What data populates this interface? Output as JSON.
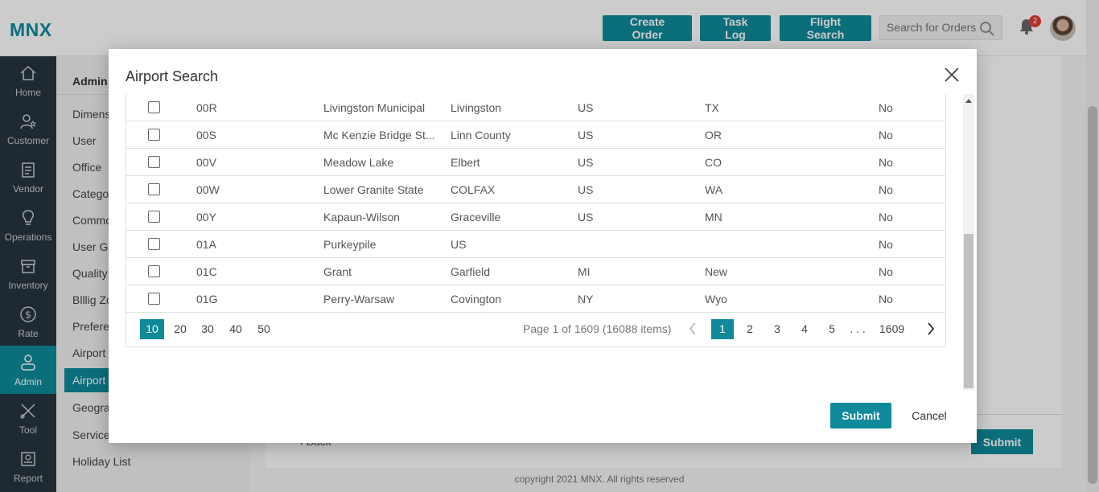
{
  "header": {
    "logo": "MNX",
    "create_order": "Create Order",
    "task_log": "Task Log",
    "flight_search": "Flight Search",
    "search_placeholder": "Search for Orders",
    "notification_count": "2"
  },
  "nav": [
    {
      "label": "Home",
      "icon": "home-icon"
    },
    {
      "label": "Customer",
      "icon": "customer-icon"
    },
    {
      "label": "Vendor",
      "icon": "vendor-icon"
    },
    {
      "label": "Operations",
      "icon": "operations-icon"
    },
    {
      "label": "Inventory",
      "icon": "inventory-icon"
    },
    {
      "label": "Rate",
      "icon": "rate-icon"
    },
    {
      "label": "Admin",
      "icon": "admin-icon"
    },
    {
      "label": "Tool",
      "icon": "tool-icon"
    },
    {
      "label": "Report",
      "icon": "report-icon"
    }
  ],
  "subnav": {
    "title": "Admin",
    "items": [
      "Dimens",
      "User",
      "Office",
      "Catego",
      "Commo",
      "User Gr",
      "Quality",
      "Blllig Zo",
      "Prefere",
      "Airport",
      "Airport",
      "Geogra",
      "Service",
      "Holiday List"
    ]
  },
  "page": {
    "back": "Back",
    "submit": "Submit",
    "footer": "copyright 2021 MNX. All rights reserved"
  },
  "modal": {
    "title": "Airport Search",
    "rows": [
      {
        "code": "00R",
        "name": "Livingston Municipal",
        "city": "Livingston",
        "country": "US",
        "state": "TX",
        "intl": "No"
      },
      {
        "code": "00S",
        "name": "Mc Kenzie Bridge St...",
        "city": "Linn County",
        "country": "US",
        "state": "OR",
        "intl": "No"
      },
      {
        "code": "00V",
        "name": "Meadow Lake",
        "city": "Elbert",
        "country": "US",
        "state": "CO",
        "intl": "No"
      },
      {
        "code": "00W",
        "name": "Lower Granite State",
        "city": "COLFAX",
        "country": "US",
        "state": "WA",
        "intl": "No"
      },
      {
        "code": "00Y",
        "name": "Kapaun-Wilson",
        "city": "Graceville",
        "country": "US",
        "state": "MN",
        "intl": "No"
      },
      {
        "code": "01A",
        "name": "Purkeypile",
        "city": "US",
        "country": "",
        "state": "",
        "intl": "No"
      },
      {
        "code": "01C",
        "name": "Grant",
        "city": "Garfield",
        "country": "MI",
        "state": "New",
        "intl": "No"
      },
      {
        "code": "01G",
        "name": "Perry-Warsaw",
        "city": "Covington",
        "country": "NY",
        "state": "Wyo",
        "intl": "No"
      }
    ],
    "page_sizes": [
      "10",
      "20",
      "30",
      "40",
      "50"
    ],
    "page_info": "Page 1 of 1609 (16088 items)",
    "pages": [
      "1",
      "2",
      "3",
      "4",
      "5",
      ". . .",
      "1609"
    ],
    "submit": "Submit",
    "cancel": "Cancel"
  }
}
